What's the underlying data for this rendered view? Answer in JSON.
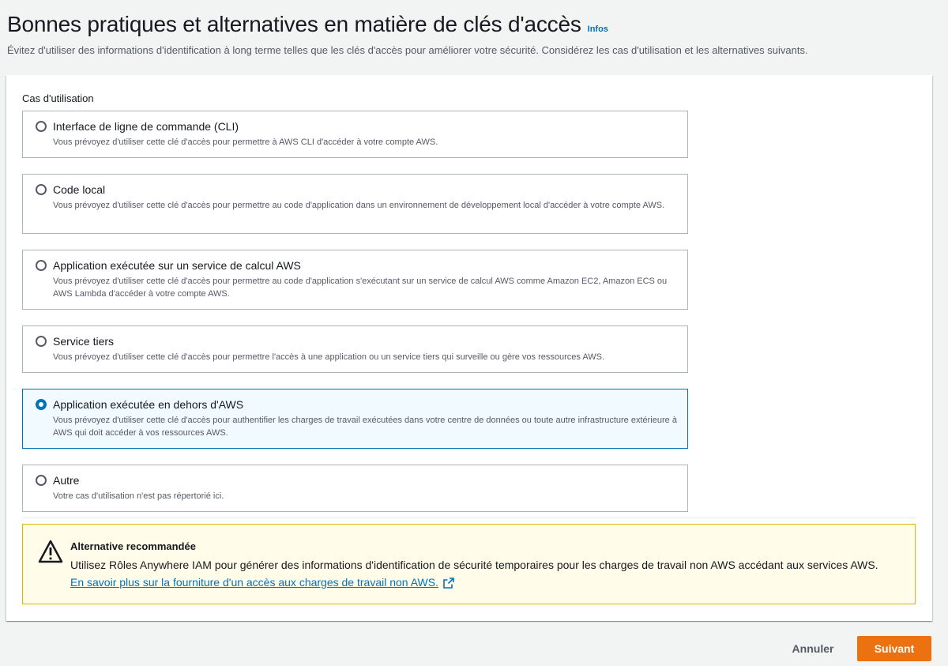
{
  "header": {
    "title": "Bonnes pratiques et alternatives en matière de clés d'accès",
    "info_link": "Infos",
    "description": "Évitez d'utiliser des informations d'identification à long terme telles que les clés d'accès pour améliorer votre sécurité. Considérez les cas d'utilisation et les alternatives suivants."
  },
  "use_cases": {
    "label": "Cas d'utilisation",
    "options": [
      {
        "title": "Interface de ligne de commande (CLI)",
        "description": "Vous prévoyez d'utiliser cette clé d'accès pour permettre à AWS CLI d'accéder à votre compte AWS.",
        "selected": false
      },
      {
        "title": "Code local",
        "description": "Vous prévoyez d'utiliser cette clé d'accès pour permettre au code d'application dans un environnement de développement local d'accéder à votre compte AWS.",
        "selected": false
      },
      {
        "title": "Application exécutée sur un service de calcul AWS",
        "description": "Vous prévoyez d'utiliser cette clé d'accès pour permettre au code d'application s'exécutant sur un service de calcul AWS comme Amazon EC2, Amazon ECS ou AWS Lambda d'accéder à votre compte AWS.",
        "selected": false
      },
      {
        "title": "Service tiers",
        "description": "Vous prévoyez d'utiliser cette clé d'accès pour permettre l'accès à une application ou un service tiers qui surveille ou gère vos ressources AWS.",
        "selected": false
      },
      {
        "title": "Application exécutée en dehors d'AWS",
        "description": "Vous prévoyez d'utiliser cette clé d'accès pour authentifier les charges de travail exécutées dans votre centre de données ou toute autre infrastructure extérieure à AWS qui doit accéder à vos ressources AWS.",
        "selected": true
      },
      {
        "title": "Autre",
        "description": "Votre cas d'utilisation n'est pas répertorié ici.",
        "selected": false
      }
    ]
  },
  "alert": {
    "title": "Alternative recommandée",
    "body": "Utilisez Rôles Anywhere IAM pour générer des informations d'identification de sécurité temporaires pour les charges de travail non AWS accédant aux services AWS.",
    "link": "En savoir plus sur la fourniture d'un accès aux charges de travail non AWS."
  },
  "actions": {
    "cancel": "Annuler",
    "next": "Suivant"
  },
  "colors": {
    "accent": "#0073bb",
    "primary_button": "#ec7211",
    "warning_border": "#ddb600",
    "warning_bg": "#fffce9"
  },
  "icons": {
    "alert": "warning-icon",
    "external": "external-link-icon"
  }
}
